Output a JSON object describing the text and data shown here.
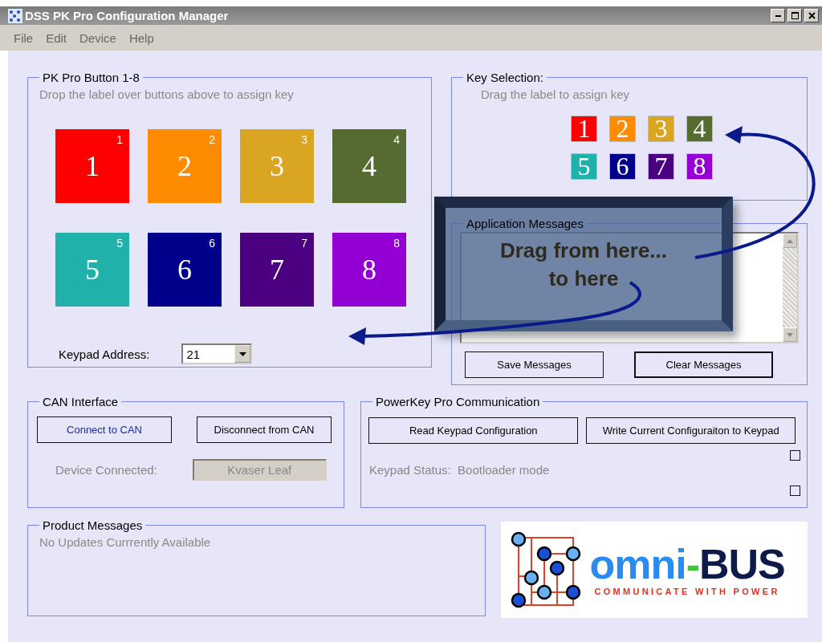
{
  "window": {
    "title": "DSS PK Pro Configuration Manager"
  },
  "menu": [
    "File",
    "Edit",
    "Device",
    "Help"
  ],
  "pk_buttons": {
    "title": "PK Pro Button 1-8",
    "hint": "Drop the label over buttons above to assign key",
    "keys": [
      {
        "label": "1",
        "badge": "1",
        "color": "#ff0000"
      },
      {
        "label": "2",
        "badge": "2",
        "color": "#ff8c00"
      },
      {
        "label": "3",
        "badge": "3",
        "color": "#daa520"
      },
      {
        "label": "4",
        "badge": "4",
        "color": "#556b2f"
      },
      {
        "label": "5",
        "badge": "5",
        "color": "#20b2aa"
      },
      {
        "label": "6",
        "badge": "6",
        "color": "#00008b"
      },
      {
        "label": "7",
        "badge": "7",
        "color": "#4b0082"
      },
      {
        "label": "8",
        "badge": "8",
        "color": "#9400d3"
      }
    ],
    "address_label": "Keypad Address:",
    "address_value": "21"
  },
  "key_selection": {
    "title": "Key Selection:",
    "hint": "Drag the label to assign key",
    "keys": [
      {
        "label": "1",
        "color": "#ff0000"
      },
      {
        "label": "2",
        "color": "#ff8c00"
      },
      {
        "label": "3",
        "color": "#daa520"
      },
      {
        "label": "4",
        "color": "#556b2f"
      },
      {
        "label": "5",
        "color": "#20b2aa"
      },
      {
        "label": "6",
        "color": "#00008b"
      },
      {
        "label": "7",
        "color": "#4b0082"
      },
      {
        "label": "8",
        "color": "#9400d3"
      }
    ]
  },
  "application_messages": {
    "title": "Application Messages",
    "buttons": [
      {
        "label": "Save Messages",
        "default": false
      },
      {
        "label": "Clear Messages",
        "default": true
      }
    ]
  },
  "can_interface": {
    "title": "CAN Interface",
    "buttons": [
      {
        "label": "Connect to CAN",
        "focused": true
      },
      {
        "label": "Disconnect from CAN",
        "focused": false
      }
    ],
    "device_label": "Device Connected:",
    "device_value": "Kvaser Leaf"
  },
  "powerkey_communication": {
    "title": "PowerKey Pro Communication",
    "buttons": [
      {
        "label": "Read Keypad Configuration"
      },
      {
        "label": "Write Current Configuraiton to Keypad"
      }
    ],
    "status_label": "Keypad Status:",
    "status_value": "Bootloader mode",
    "checkboxes": [
      {
        "checked": false
      },
      {
        "checked": false
      }
    ]
  },
  "product_messages": {
    "title": "Product Messages",
    "text": "No Updates Currrently Available"
  },
  "logo": {
    "name_start": "omni",
    "separator": "-",
    "name_end": "BUS",
    "tagline": "COMMUNICATE WITH POWER"
  },
  "callout": {
    "lines": [
      "Drag from here...",
      "to here"
    ]
  }
}
